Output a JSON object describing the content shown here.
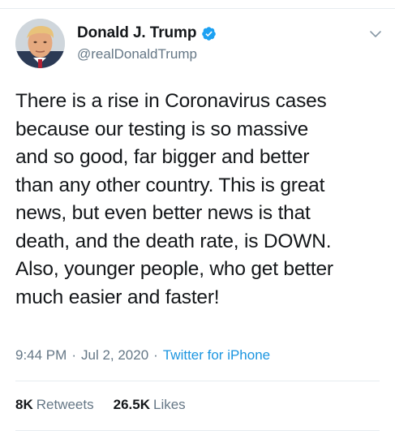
{
  "author": {
    "display_name": "Donald J. Trump",
    "handle": "@realDonaldTrump",
    "verified_icon": "verified-badge-icon",
    "avatar_icon": "avatar"
  },
  "menu_icon": "chevron-down-icon",
  "tweet": {
    "lines": [
      "There is a rise in Coronavirus cases",
      "because our testing is so massive",
      "and so good, far bigger and better",
      "than any other country. This is great",
      "news, but even better news is that",
      "death, and the death rate, is DOWN.",
      "Also, younger people, who get better",
      "much easier and faster!"
    ]
  },
  "meta": {
    "time": "9:44 PM",
    "separator_1": "·",
    "date": "Jul 2, 2020",
    "separator_2": "·",
    "source": "Twitter for iPhone"
  },
  "stats": {
    "retweets_count": "8K",
    "retweets_label": "Retweets",
    "likes_count": "26.5K",
    "likes_label": "Likes"
  },
  "colors": {
    "text_primary": "#14171a",
    "text_secondary": "#657786",
    "link": "#1b95e0",
    "verified": "#1da1f2",
    "divider": "#e6ecf0"
  }
}
